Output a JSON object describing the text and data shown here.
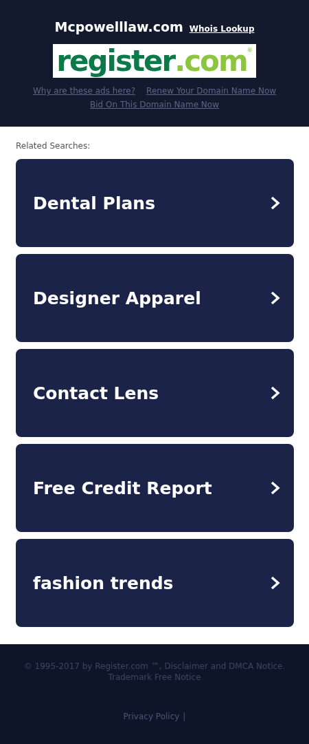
{
  "header": {
    "domain": "Mcpowelllaw.com",
    "whois_link": "Whois Lookup",
    "logo": {
      "main": "register",
      "suffix": ".com",
      "mark": "®"
    },
    "links": [
      "Why are these ads here?",
      "Renew Your Domain Name Now",
      "Bid On This Domain Name Now"
    ]
  },
  "related": {
    "label": "Related Searches:",
    "items": [
      "Dental Plans",
      "Designer Apparel",
      "Contact Lens",
      "Free Credit Report",
      "fashion trends"
    ]
  },
  "footer": {
    "copyright": "© 1995-2017 by Register.com ™, Disclaimer and DMCA Notice.",
    "trademark": "Trademark Free Notice",
    "privacy": "Privacy Policy",
    "separator": "|"
  }
}
